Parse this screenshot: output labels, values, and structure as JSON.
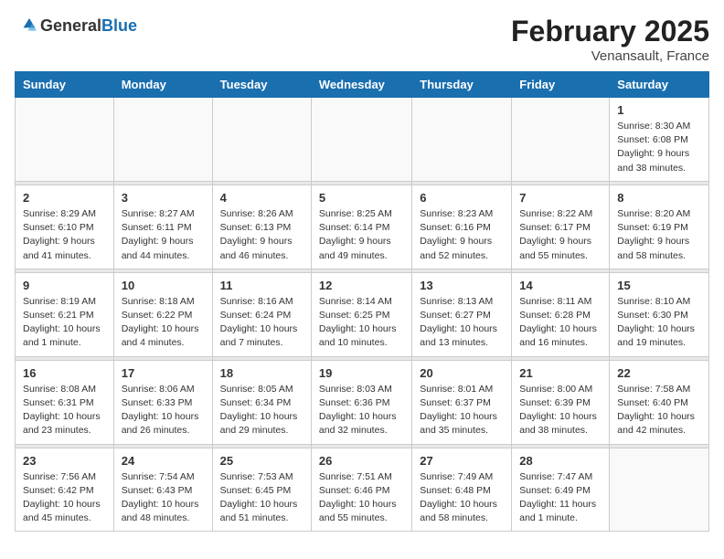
{
  "header": {
    "logo_general": "General",
    "logo_blue": "Blue",
    "month": "February 2025",
    "location": "Venansault, France"
  },
  "days_of_week": [
    "Sunday",
    "Monday",
    "Tuesday",
    "Wednesday",
    "Thursday",
    "Friday",
    "Saturday"
  ],
  "weeks": [
    {
      "days": [
        {
          "num": "",
          "info": ""
        },
        {
          "num": "",
          "info": ""
        },
        {
          "num": "",
          "info": ""
        },
        {
          "num": "",
          "info": ""
        },
        {
          "num": "",
          "info": ""
        },
        {
          "num": "",
          "info": ""
        },
        {
          "num": "1",
          "info": "Sunrise: 8:30 AM\nSunset: 6:08 PM\nDaylight: 9 hours and 38 minutes."
        }
      ]
    },
    {
      "days": [
        {
          "num": "2",
          "info": "Sunrise: 8:29 AM\nSunset: 6:10 PM\nDaylight: 9 hours and 41 minutes."
        },
        {
          "num": "3",
          "info": "Sunrise: 8:27 AM\nSunset: 6:11 PM\nDaylight: 9 hours and 44 minutes."
        },
        {
          "num": "4",
          "info": "Sunrise: 8:26 AM\nSunset: 6:13 PM\nDaylight: 9 hours and 46 minutes."
        },
        {
          "num": "5",
          "info": "Sunrise: 8:25 AM\nSunset: 6:14 PM\nDaylight: 9 hours and 49 minutes."
        },
        {
          "num": "6",
          "info": "Sunrise: 8:23 AM\nSunset: 6:16 PM\nDaylight: 9 hours and 52 minutes."
        },
        {
          "num": "7",
          "info": "Sunrise: 8:22 AM\nSunset: 6:17 PM\nDaylight: 9 hours and 55 minutes."
        },
        {
          "num": "8",
          "info": "Sunrise: 8:20 AM\nSunset: 6:19 PM\nDaylight: 9 hours and 58 minutes."
        }
      ]
    },
    {
      "days": [
        {
          "num": "9",
          "info": "Sunrise: 8:19 AM\nSunset: 6:21 PM\nDaylight: 10 hours and 1 minute."
        },
        {
          "num": "10",
          "info": "Sunrise: 8:18 AM\nSunset: 6:22 PM\nDaylight: 10 hours and 4 minutes."
        },
        {
          "num": "11",
          "info": "Sunrise: 8:16 AM\nSunset: 6:24 PM\nDaylight: 10 hours and 7 minutes."
        },
        {
          "num": "12",
          "info": "Sunrise: 8:14 AM\nSunset: 6:25 PM\nDaylight: 10 hours and 10 minutes."
        },
        {
          "num": "13",
          "info": "Sunrise: 8:13 AM\nSunset: 6:27 PM\nDaylight: 10 hours and 13 minutes."
        },
        {
          "num": "14",
          "info": "Sunrise: 8:11 AM\nSunset: 6:28 PM\nDaylight: 10 hours and 16 minutes."
        },
        {
          "num": "15",
          "info": "Sunrise: 8:10 AM\nSunset: 6:30 PM\nDaylight: 10 hours and 19 minutes."
        }
      ]
    },
    {
      "days": [
        {
          "num": "16",
          "info": "Sunrise: 8:08 AM\nSunset: 6:31 PM\nDaylight: 10 hours and 23 minutes."
        },
        {
          "num": "17",
          "info": "Sunrise: 8:06 AM\nSunset: 6:33 PM\nDaylight: 10 hours and 26 minutes."
        },
        {
          "num": "18",
          "info": "Sunrise: 8:05 AM\nSunset: 6:34 PM\nDaylight: 10 hours and 29 minutes."
        },
        {
          "num": "19",
          "info": "Sunrise: 8:03 AM\nSunset: 6:36 PM\nDaylight: 10 hours and 32 minutes."
        },
        {
          "num": "20",
          "info": "Sunrise: 8:01 AM\nSunset: 6:37 PM\nDaylight: 10 hours and 35 minutes."
        },
        {
          "num": "21",
          "info": "Sunrise: 8:00 AM\nSunset: 6:39 PM\nDaylight: 10 hours and 38 minutes."
        },
        {
          "num": "22",
          "info": "Sunrise: 7:58 AM\nSunset: 6:40 PM\nDaylight: 10 hours and 42 minutes."
        }
      ]
    },
    {
      "days": [
        {
          "num": "23",
          "info": "Sunrise: 7:56 AM\nSunset: 6:42 PM\nDaylight: 10 hours and 45 minutes."
        },
        {
          "num": "24",
          "info": "Sunrise: 7:54 AM\nSunset: 6:43 PM\nDaylight: 10 hours and 48 minutes."
        },
        {
          "num": "25",
          "info": "Sunrise: 7:53 AM\nSunset: 6:45 PM\nDaylight: 10 hours and 51 minutes."
        },
        {
          "num": "26",
          "info": "Sunrise: 7:51 AM\nSunset: 6:46 PM\nDaylight: 10 hours and 55 minutes."
        },
        {
          "num": "27",
          "info": "Sunrise: 7:49 AM\nSunset: 6:48 PM\nDaylight: 10 hours and 58 minutes."
        },
        {
          "num": "28",
          "info": "Sunrise: 7:47 AM\nSunset: 6:49 PM\nDaylight: 11 hours and 1 minute."
        },
        {
          "num": "",
          "info": ""
        }
      ]
    }
  ]
}
